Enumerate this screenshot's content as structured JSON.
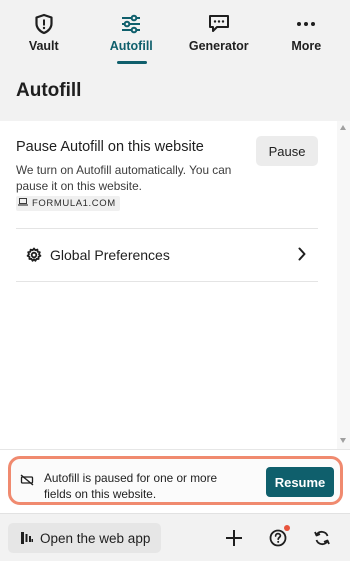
{
  "nav": {
    "tabs": [
      {
        "label": "Vault",
        "icon": "shield-alert-icon",
        "active": false
      },
      {
        "label": "Autofill",
        "icon": "sliders-icon",
        "active": true
      },
      {
        "label": "Generator",
        "icon": "chat-dots-icon",
        "active": false
      },
      {
        "label": "More",
        "icon": "ellipsis-icon",
        "active": false
      }
    ]
  },
  "page": {
    "title": "Autofill"
  },
  "pause_section": {
    "title": "Pause Autofill on this website",
    "description": "We turn on Autofill automatically. You can pause it on this website.",
    "site": "FORMULA1.COM",
    "pause_label": "Pause"
  },
  "preferences": {
    "label": "Global Preferences"
  },
  "banner": {
    "text": "Autofill is paused for one or more fields on this website.",
    "resume_label": "Resume"
  },
  "bottom": {
    "web_app_label": "Open the web app"
  },
  "colors": {
    "accent": "#0f5f6c",
    "highlight_border": "#f08a6f",
    "notification": "#e8543d"
  }
}
